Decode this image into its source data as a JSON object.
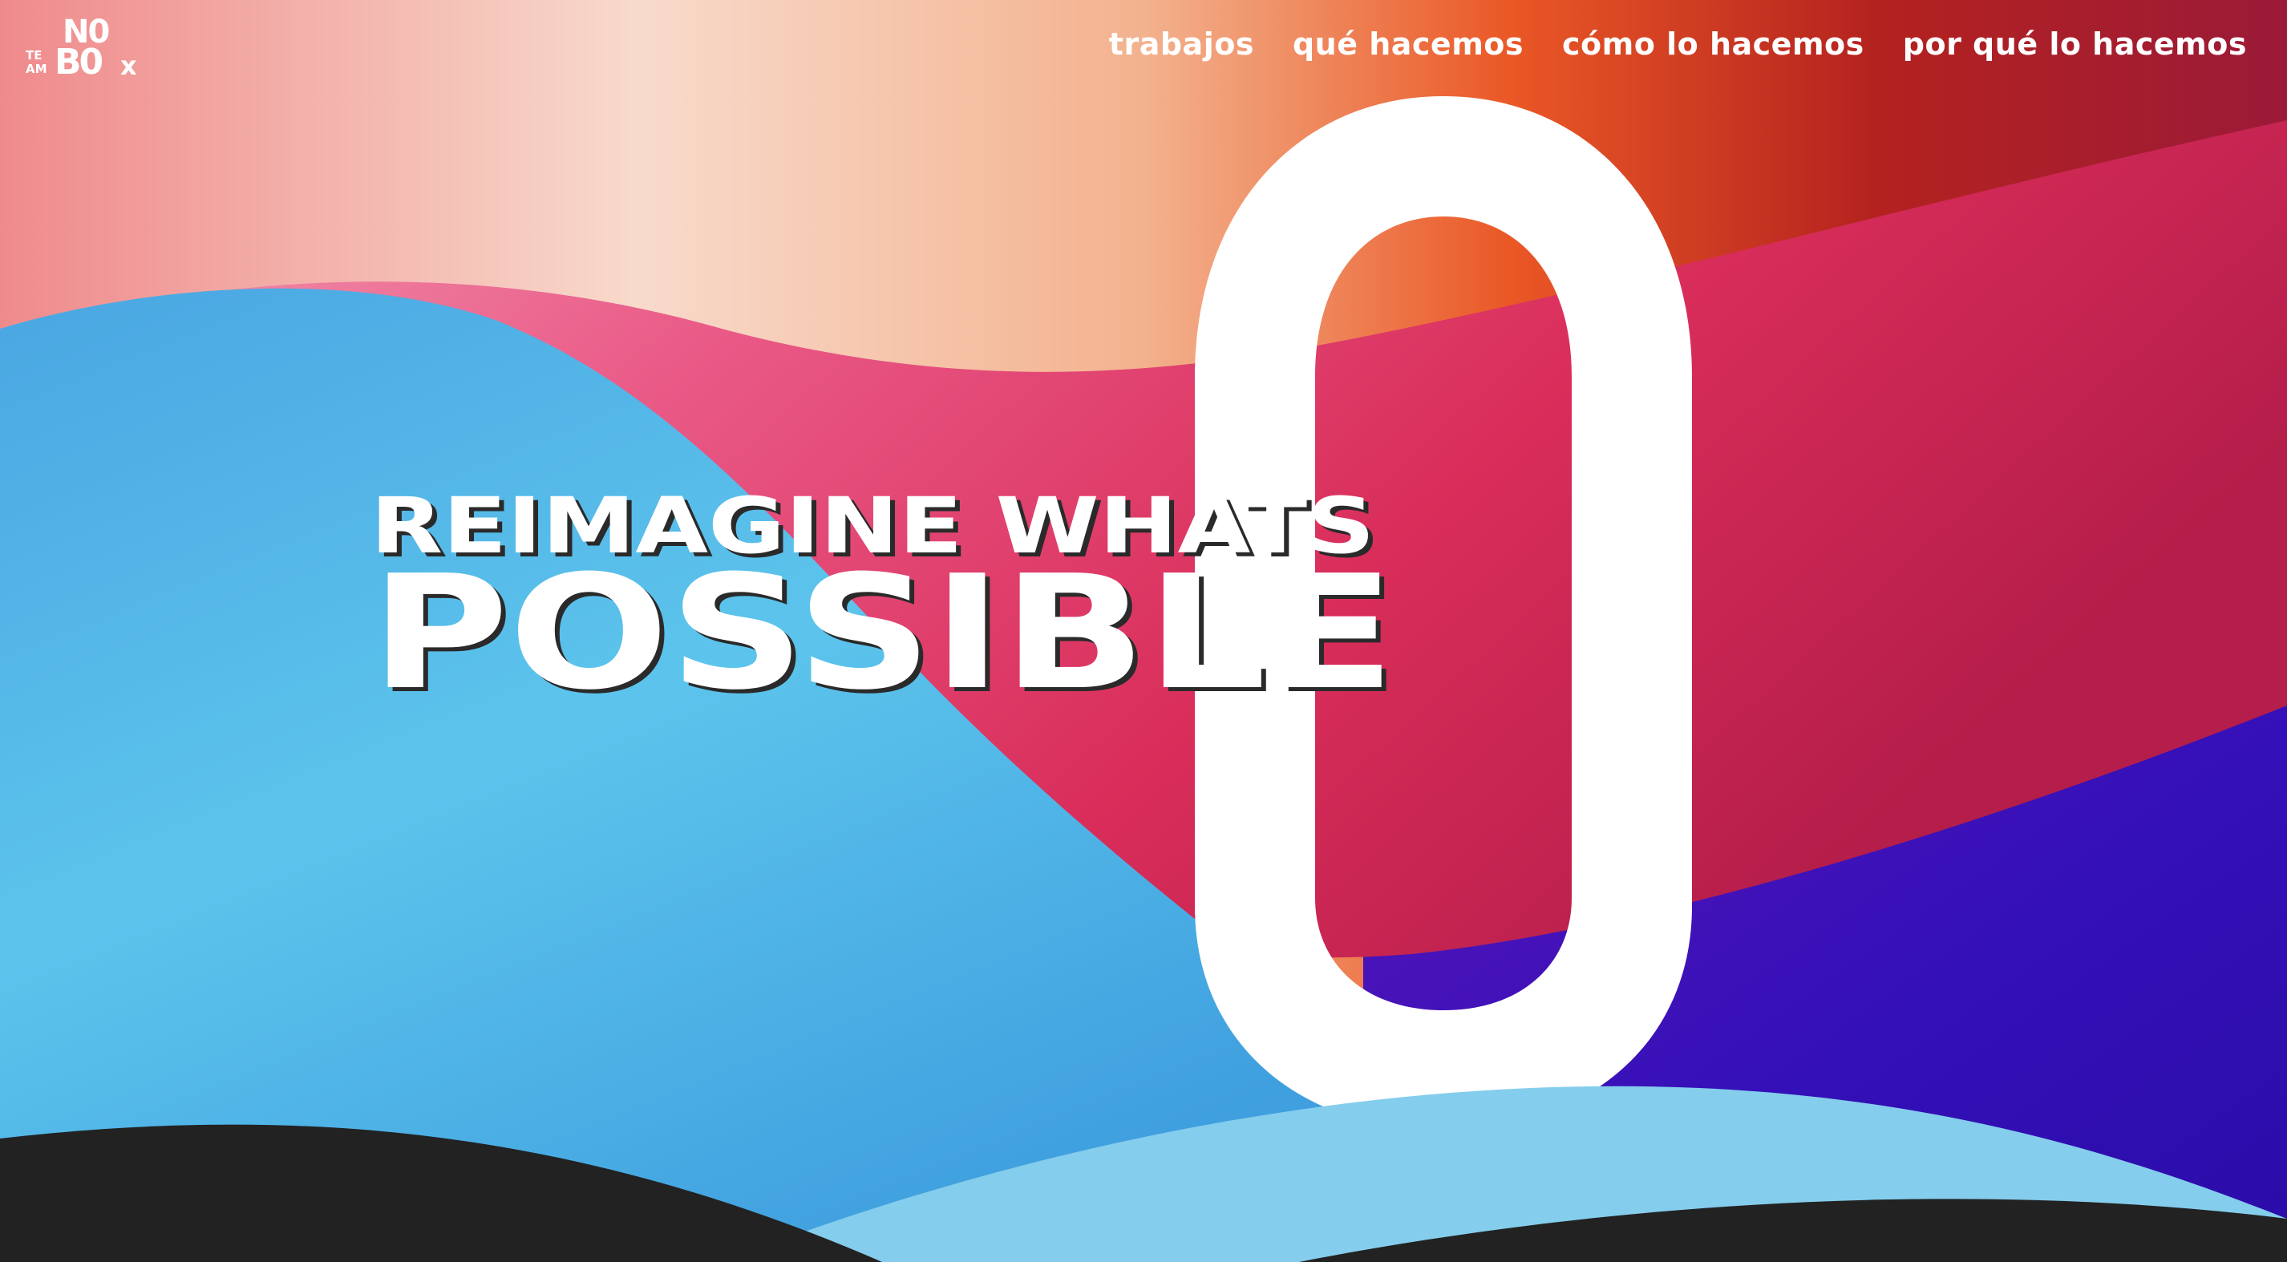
{
  "logo": {
    "line1": "TE",
    "line2": "AM",
    "top": "N0",
    "bottom": "B0",
    "suffix": "x"
  },
  "nav": {
    "items": [
      {
        "label": "trabajos"
      },
      {
        "label": "qué hacemos"
      },
      {
        "label": "cómo lo hacemos"
      },
      {
        "label": "por qué lo hacemos"
      }
    ]
  },
  "hero": {
    "line1": "REIMAGINE WHATS",
    "line2": "POSSIBLE"
  },
  "colors": {
    "blue": "#55bde9",
    "pink": "#e94576",
    "orange": "#e9562a",
    "peach": "#f6cdb8",
    "purple": "#3a0fb4",
    "dark": "#222222",
    "light_blue": "#84cdec",
    "white": "#ffffff"
  }
}
